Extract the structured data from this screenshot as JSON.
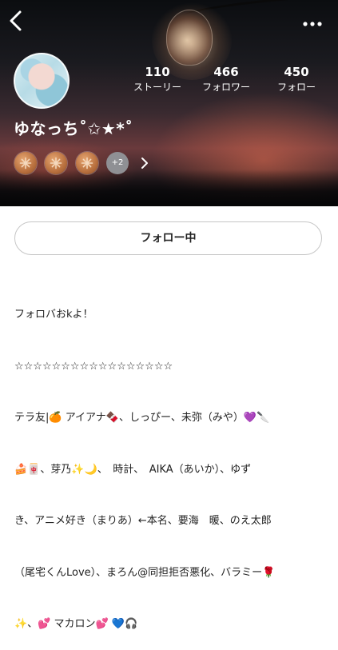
{
  "profile": {
    "username": "ゆなっち",
    "username_decoration": "˚✩★*˚"
  },
  "stats": [
    {
      "value": "110",
      "label": "ストーリー"
    },
    {
      "value": "466",
      "label": "フォロワー"
    },
    {
      "value": "450",
      "label": "フォロー"
    }
  ],
  "badges": {
    "extra_count": "+2"
  },
  "follow_button": {
    "label": "フォロー中"
  },
  "bio": {
    "lines": [
      "フォロバおkよ！",
      "☆☆☆☆☆☆☆☆☆☆☆☆☆☆☆☆☆",
      "テラ友|🍊 アイアナ🍫、しっぴー、未弥（みや）💜🔪",
      "🍰🀄、芽乃✨🌙、　時計、　AIKA（あいか）、ゆず",
      "き、アニメ好き（まりあ）←本名、要海　暖、のえ太郎",
      "（尾宅くんLove）、まろん@同担拒否悪化、バラミー🌹",
      "✨、💕 マカロン💕 💙🎧"
    ]
  },
  "colors": {
    "hero_text": "#ffffff",
    "badge_bronze": "#b8703e",
    "badge_more": "#8f9094",
    "button_border": "#c6c6c6"
  }
}
